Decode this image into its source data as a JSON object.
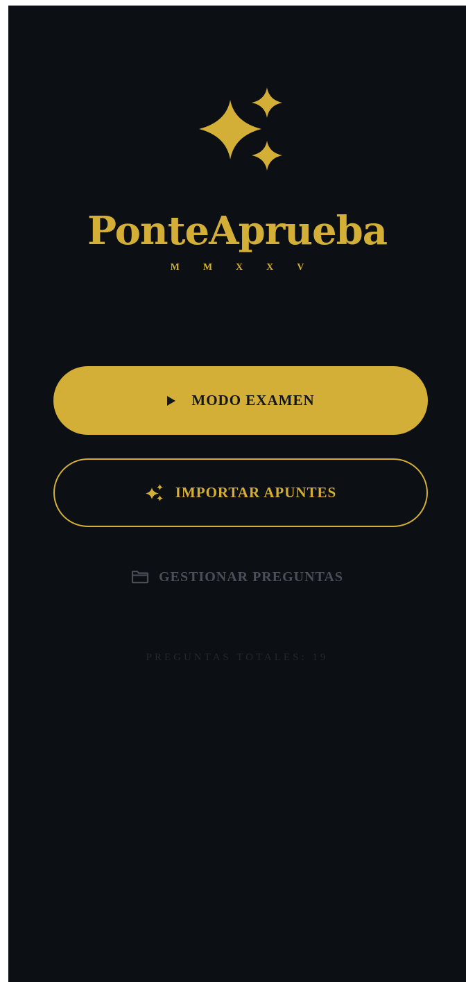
{
  "app": {
    "title": "PonteAprueba",
    "subtitle": "MMXXV",
    "logo_icon": "sparkles-icon"
  },
  "actions": {
    "exam_mode": {
      "label": "MODO EXAMEN",
      "icon": "play-icon"
    },
    "import_notes": {
      "label": "IMPORTAR APUNTES",
      "icon": "sparkles-icon"
    },
    "manage_questions": {
      "label": "GESTIONAR PREGUNTAS",
      "icon": "folder-icon"
    }
  },
  "stats": {
    "total_questions": "PREGUNTAS TOTALES: 19"
  },
  "colors": {
    "background": "#0c1014",
    "gold": "#d4af37",
    "button_text_dark": "#12161a",
    "muted": "#4a4f57",
    "faint": "#23282e"
  }
}
